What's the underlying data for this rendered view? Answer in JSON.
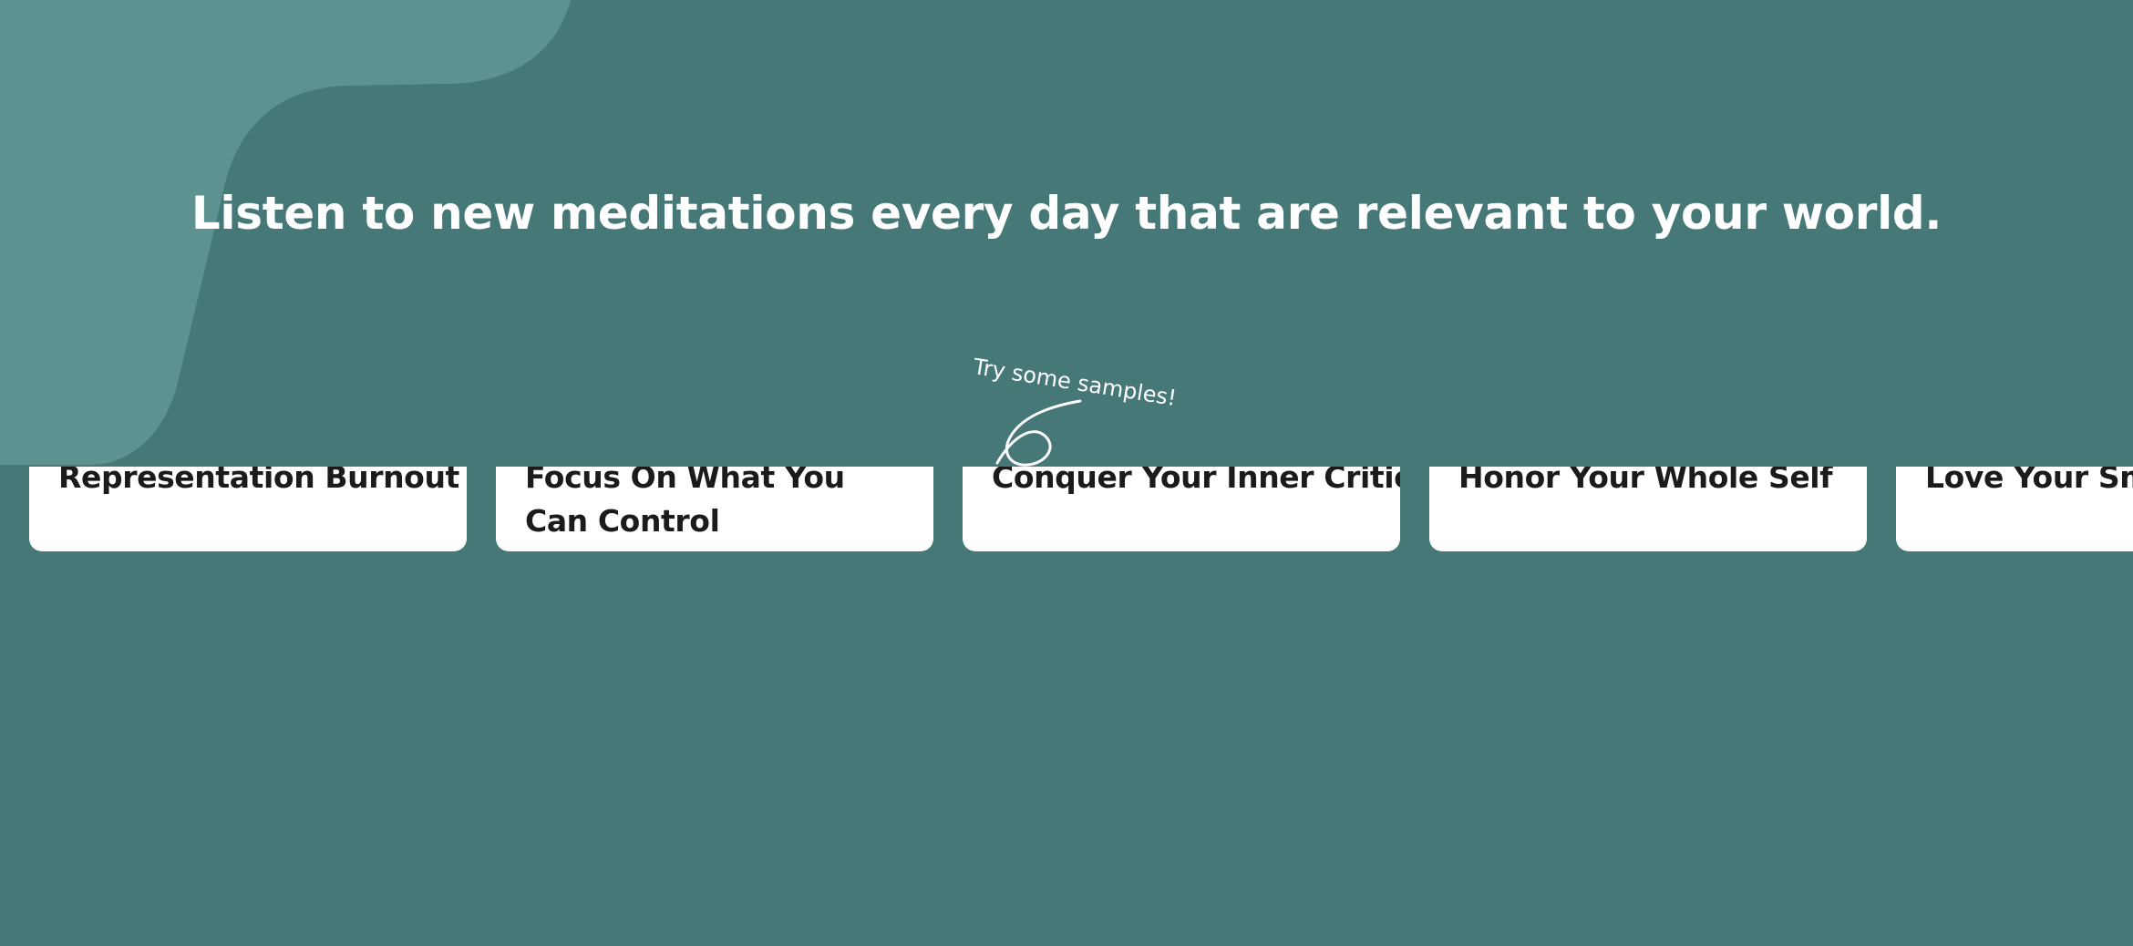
{
  "headline": "Listen to new meditations every day that are relevant to your world.",
  "samples_hint": "Try some samples!",
  "cards": [
    {
      "title": "Representation Burnout"
    },
    {
      "title": "Focus On What You Can Control"
    },
    {
      "title": "Conquer Your Inner Critic"
    },
    {
      "title": "Honor Your Whole Self"
    },
    {
      "title": "Love Your Sma"
    }
  ],
  "colors": {
    "background": "#467878",
    "accent_shape": "#5e9290",
    "card": "#ffffff",
    "card_text": "#1b1b1b",
    "headline_text": "#ffffff"
  }
}
